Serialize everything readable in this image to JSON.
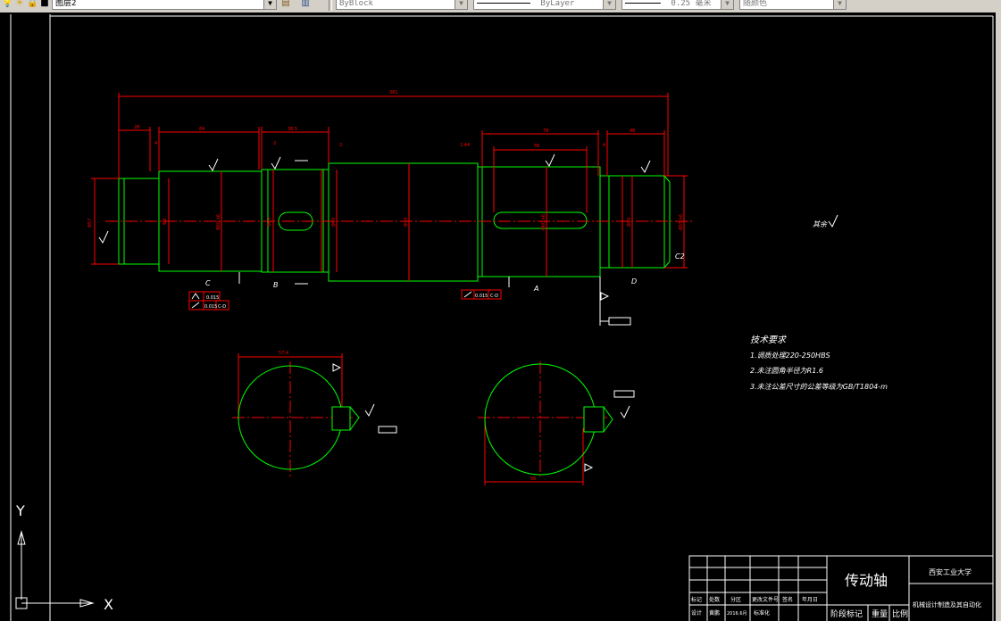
{
  "toolbar": {
    "layer_name": "图层2",
    "color_value": "ByBlock",
    "linetype_value": "ByLayer",
    "lineweight_value": "0.25 毫米",
    "plotstyle_value": "随颜色"
  },
  "drawing": {
    "dims": {
      "overall": "381",
      "seg1": "28",
      "seg2": "84",
      "seg3": "38.5",
      "seg4": "78",
      "seg5": "48",
      "key1": "56",
      "gap1": "4",
      "gap2": "2",
      "gap3": "2",
      "gap4": "2.44",
      "gap5": "4",
      "dia_left": "Φ57",
      "dia_2": "Φ8",
      "dia_3": "Φ60 k6",
      "dia_4": "Φ63",
      "dia_5": "Φ60",
      "dia_6": "Φ70",
      "dia_7": "Φ60 k6",
      "dia_8": "Φ60",
      "dia_9": "Φ55 k6",
      "width_bottom_left": "57.4",
      "width_bottom_right": "56"
    },
    "section_labels": [
      "C",
      "B",
      "A",
      "D"
    ],
    "chamfer": "C2",
    "tolerance_frames": {
      "frame1": [
        "0.015"
      ],
      "frame2": [
        "0.015",
        "C-D"
      ],
      "frame3": [
        "0.015",
        "C-D"
      ]
    },
    "roughness_note": "其余",
    "tech_req": {
      "title": "技术要求",
      "lines": [
        "1.调质处理220-250HBS",
        "2.未注圆角半径为R1.6",
        "3.未注公差尺寸的公差等级为GB/T1804-m"
      ]
    }
  },
  "title_block": {
    "part_name": "传动轴",
    "school": "西安工业大学",
    "subtitle": "机械设计制造及其自动化",
    "row_labels": [
      "标记",
      "处数",
      "分区",
      "更改文件号",
      "签名",
      "年月日"
    ],
    "row2_labels": [
      "设计",
      "黄鹏",
      "2016.6月",
      "标准化"
    ],
    "stage_label": "阶段标记",
    "weight_label": "重量",
    "scale_label": "比例"
  },
  "ucs": {
    "y_label": "Y",
    "x_label": "X"
  },
  "colors": {
    "outline": "#00ff00",
    "dimension": "#ff0000",
    "text": "#ffffff",
    "background": "#000000"
  }
}
